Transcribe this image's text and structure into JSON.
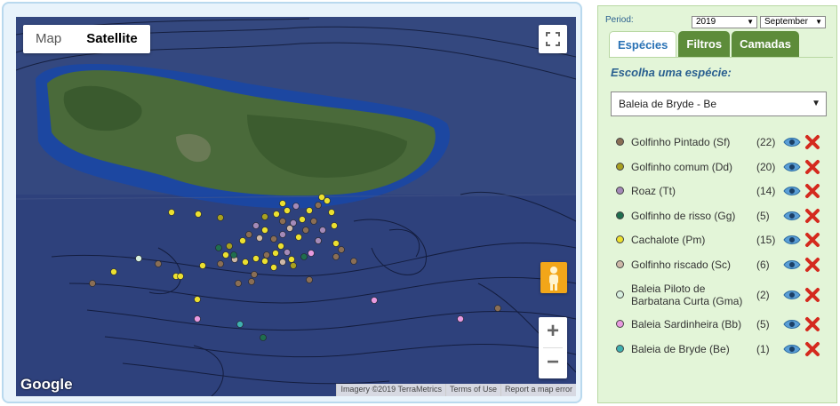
{
  "map": {
    "type_map": "Map",
    "type_satellite": "Satellite",
    "logo": "Google",
    "attribution": [
      "Imagery ©2019 TerraMetrics",
      "Terms of Use",
      "Report a map error"
    ],
    "zoom_in": "+",
    "zoom_out": "−"
  },
  "panel": {
    "period_label": "Period:",
    "year": "2019",
    "month": "September",
    "tabs": [
      "Espécies",
      "Filtros",
      "Camadas"
    ],
    "choose_label": "Escolha uma espécie:",
    "selected_species": "Baleia de Bryde - Be",
    "species": [
      {
        "name": "Golfinho Pintado (Sf)",
        "count": "(22)",
        "color": "#8a6e55"
      },
      {
        "name": "Golfinho comum (Dd)",
        "count": "(20)",
        "color": "#a8a020"
      },
      {
        "name": "Roaz (Tt)",
        "count": "(14)",
        "color": "#a48ab8"
      },
      {
        "name": "Golfinho de risso (Gg)",
        "count": "(5)",
        "color": "#1f6e4e"
      },
      {
        "name": "Cachalote (Pm)",
        "count": "(15)",
        "color": "#ece030"
      },
      {
        "name": "Golfinho riscado (Sc)",
        "count": "(6)",
        "color": "#cdb8a8"
      },
      {
        "name": "Baleia Piloto de Barbatana Curta (Gma)",
        "name_line1": "Baleia Piloto de",
        "name_line2": "Barbatana Curta (Gma)",
        "count": "(2)",
        "color": "#d8f0e0"
      },
      {
        "name": "Baleia Sardinheira (Bb)",
        "count": "(5)",
        "color": "#e89ae0"
      },
      {
        "name": "Baleia de Bryde (Be)",
        "count": "(1)",
        "color": "#3fb0b0"
      }
    ]
  }
}
